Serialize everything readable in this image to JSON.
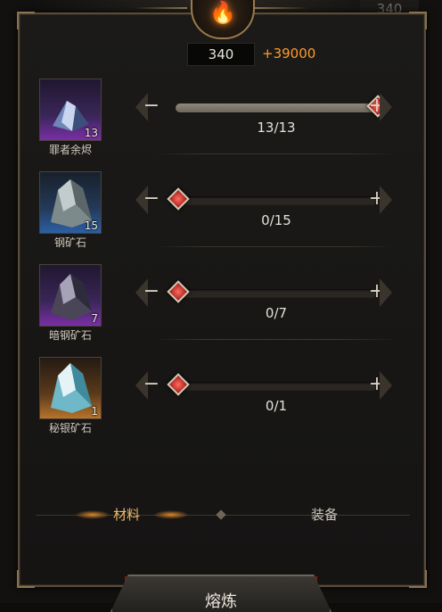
{
  "header": {
    "corner_value": "340",
    "current_value": "340",
    "gain_value": "+39000"
  },
  "materials": [
    {
      "name": "罪者余烬",
      "count": "13",
      "amount": "13/13",
      "fill": 1.0,
      "rarity": "purple"
    },
    {
      "name": "钢矿石",
      "count": "15",
      "amount": "0/15",
      "fill": 0.0,
      "rarity": "blue"
    },
    {
      "name": "暗钢矿石",
      "count": "7",
      "amount": "0/7",
      "fill": 0.0,
      "rarity": "purple"
    },
    {
      "name": "秘银矿石",
      "count": "1",
      "amount": "0/1",
      "fill": 0.0,
      "rarity": "orange"
    }
  ],
  "controls": {
    "minus": "−",
    "plus": "+"
  },
  "tabs": {
    "materials": "材料",
    "equipment": "装备"
  },
  "action": {
    "smelt_label": "熔炼"
  },
  "colors": {
    "accent_orange": "#ff9a2c",
    "knob_red": "#c3251f",
    "frame_gold": "#8a7250"
  }
}
